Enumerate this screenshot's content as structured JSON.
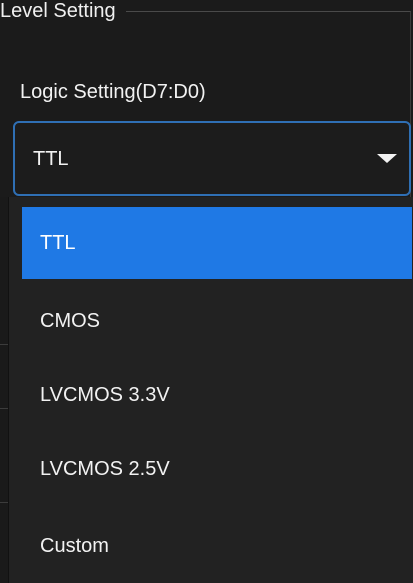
{
  "group": {
    "title": "Level Setting"
  },
  "logic": {
    "label": "Logic Setting(D7:D0)",
    "selected_value": "TTL",
    "options": [
      {
        "label": "TTL",
        "selected": true
      },
      {
        "label": "CMOS",
        "selected": false
      },
      {
        "label": "LVCMOS 3.3V",
        "selected": false
      },
      {
        "label": "LVCMOS 2.5V",
        "selected": false
      },
      {
        "label": "Custom",
        "selected": false
      }
    ]
  },
  "colors": {
    "highlight": "#1f79e5",
    "focus_border": "#2f6fb4",
    "background": "#1b1b1b"
  },
  "icons": {
    "dropdown_arrow": "chevron-down-icon"
  }
}
